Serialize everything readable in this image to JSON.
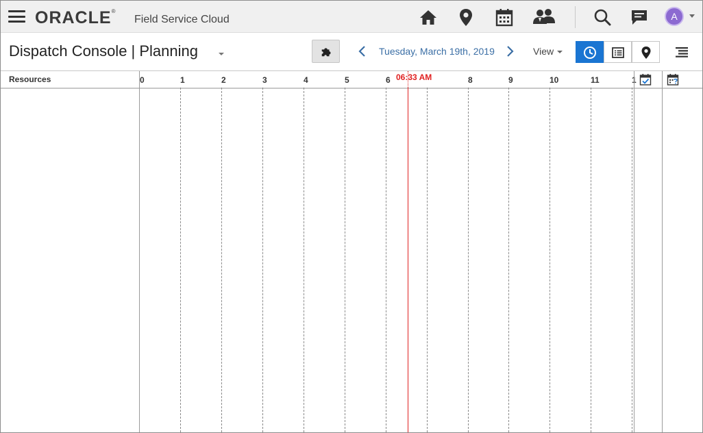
{
  "app": {
    "logo": "ORACLE",
    "product": "Field Service Cloud",
    "avatar_initial": "A"
  },
  "toolbar_icons": [
    "home-icon",
    "location-pin-icon",
    "calendar-icon",
    "users-icon",
    "search-icon",
    "message-icon"
  ],
  "page": {
    "title": "Dispatch Console | Planning",
    "date": "Tuesday, March 19th, 2019",
    "view_label": "View"
  },
  "view_modes": [
    {
      "name": "time-view",
      "icon": "clock-icon",
      "active": true
    },
    {
      "name": "list-view",
      "icon": "list-icon",
      "active": false
    },
    {
      "name": "map-view",
      "icon": "map-pin-icon",
      "active": false
    }
  ],
  "timeline": {
    "resources_label": "Resources",
    "hours": [
      "0",
      "1",
      "2",
      "3",
      "4",
      "5",
      "6",
      "8",
      "9",
      "10",
      "11",
      "1"
    ],
    "current_time": "06:33 AM"
  },
  "colors": {
    "accent": "#1a75d2",
    "date_link": "#3a6ea5",
    "current_time": "#e02020",
    "avatar": "#8c6ad1"
  }
}
